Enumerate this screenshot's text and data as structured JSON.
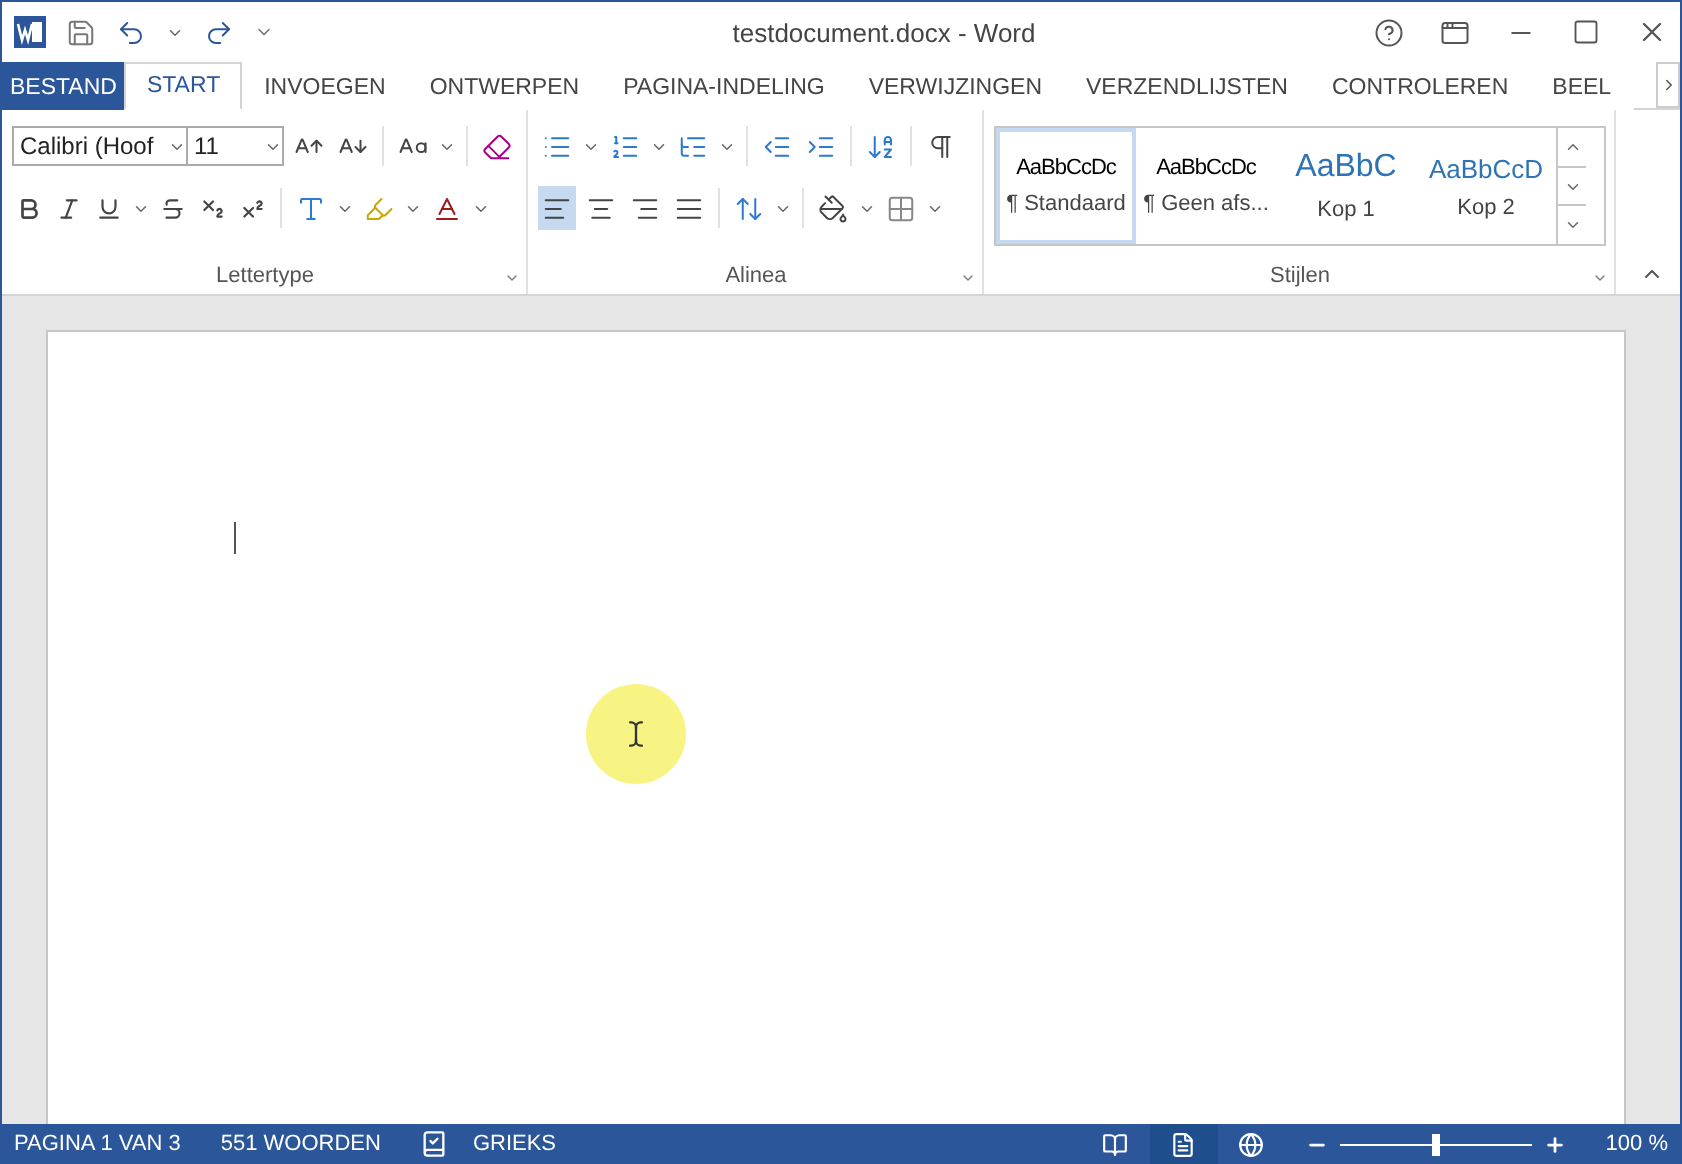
{
  "window": {
    "title": "testdocument.docx - Word"
  },
  "tabs": [
    {
      "label": "BESTAND",
      "kind": "file",
      "selected": false
    },
    {
      "label": "START",
      "kind": "tab",
      "selected": true
    },
    {
      "label": "INVOEGEN",
      "kind": "tab",
      "selected": false
    },
    {
      "label": "ONTWERPEN",
      "kind": "tab",
      "selected": false
    },
    {
      "label": "PAGINA-INDELING",
      "kind": "tab",
      "selected": false
    },
    {
      "label": "VERWIJZINGEN",
      "kind": "tab",
      "selected": false
    },
    {
      "label": "VERZENDLIJSTEN",
      "kind": "tab",
      "selected": false
    },
    {
      "label": "CONTROLEREN",
      "kind": "tab",
      "selected": false
    },
    {
      "label": "BEEL",
      "kind": "tab",
      "selected": false
    }
  ],
  "font_group": {
    "label": "Lettertype",
    "font_name": "Calibri (Hoof",
    "font_size": "11"
  },
  "paragraph_group": {
    "label": "Alinea",
    "alignment": [
      {
        "kind": "left",
        "selected": true
      },
      {
        "kind": "center",
        "selected": false
      },
      {
        "kind": "right",
        "selected": false
      },
      {
        "kind": "justify",
        "selected": false
      }
    ]
  },
  "styles_group": {
    "label": "Stijlen",
    "styles": [
      {
        "preview": "AaBbCcDc",
        "name": "¶ Standaard",
        "kind": "body",
        "selected": true
      },
      {
        "preview": "AaBbCcDc",
        "name": "¶ Geen afs...",
        "kind": "body",
        "selected": false
      },
      {
        "preview": "AaBbC",
        "name": "Kop 1",
        "kind": "heading1",
        "selected": false
      },
      {
        "preview": "AaBbCcD",
        "name": "Kop 2",
        "kind": "heading2",
        "selected": false
      }
    ]
  },
  "status_bar": {
    "page": "PAGINA 1 VAN 3",
    "words": "551 WOORDEN",
    "language": "GRIEKS",
    "zoom": "100 %",
    "views": [
      {
        "kind": "read",
        "selected": false
      },
      {
        "kind": "print",
        "selected": true
      },
      {
        "kind": "web",
        "selected": false
      }
    ],
    "zoom_slider": {
      "level": 0.5
    }
  }
}
